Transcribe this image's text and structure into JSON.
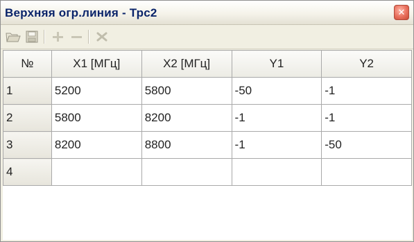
{
  "window": {
    "title": "Верхняя огр.линия - Трс2",
    "close_glyph": "✕"
  },
  "toolbar": {
    "buttons": [
      {
        "name": "open-folder-icon"
      },
      {
        "name": "save-disk-icon"
      },
      {
        "name": "add-plus-icon"
      },
      {
        "name": "remove-minus-icon"
      },
      {
        "name": "delete-x-icon"
      }
    ]
  },
  "grid": {
    "headers": [
      "№",
      "X1 [МГц]",
      "X2 [МГц]",
      "Y1",
      "Y2"
    ],
    "rows": [
      {
        "num": "1",
        "x1": "5200",
        "x2": "5800",
        "y1": "-50",
        "y2": "-1"
      },
      {
        "num": "2",
        "x1": "5800",
        "x2": "8200",
        "y1": "-1",
        "y2": "-1"
      },
      {
        "num": "3",
        "x1": "8200",
        "x2": "8800",
        "y1": "-1",
        "y2": "-50"
      },
      {
        "num": "4",
        "x1": "",
        "x2": "",
        "y1": "",
        "y2": ""
      }
    ]
  },
  "colors": {
    "title_text": "#0a246a",
    "close_button": "#e86f5c",
    "grid_line": "#a9a9a9",
    "header_bg": "#ecebe4"
  }
}
